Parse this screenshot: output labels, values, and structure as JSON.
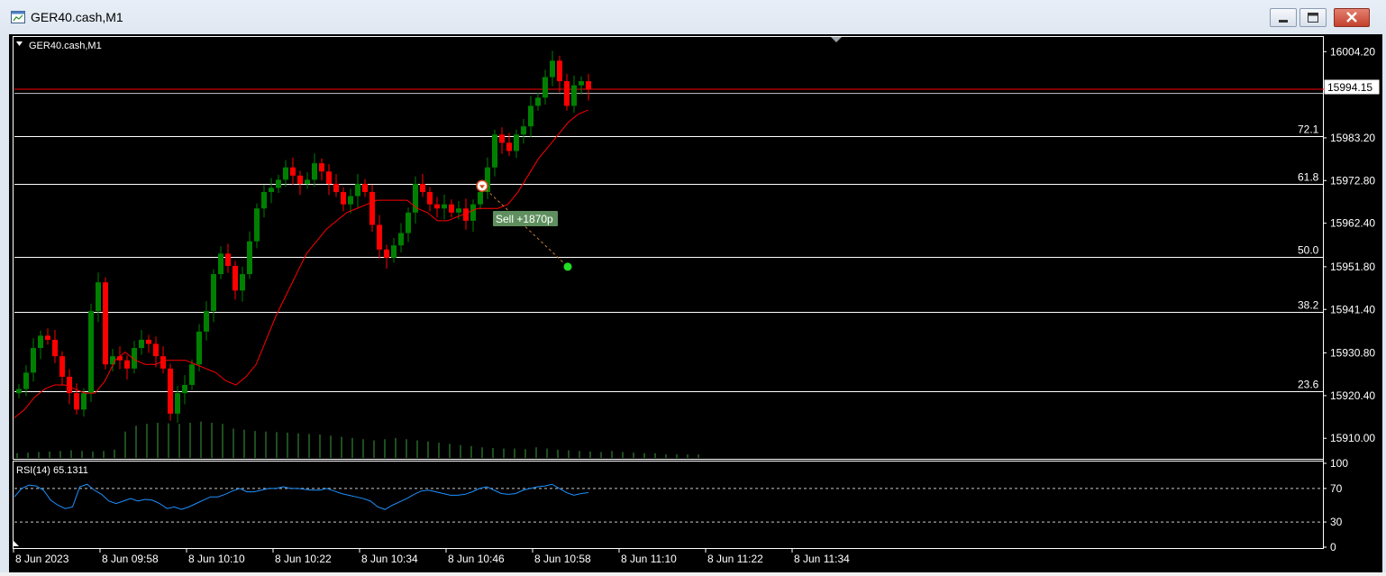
{
  "window": {
    "title": "GER40.cash,M1",
    "icons": {
      "app": "chart-window-icon",
      "minimize": "minimize-icon",
      "maximize": "maximize-icon",
      "close": "close-icon"
    }
  },
  "chart": {
    "symbol_label": "GER40.cash,M1",
    "current_price": "15994.15",
    "trade_label": "Sell +1870p",
    "rsi_label": "RSI(14) 65.1311",
    "colors": {
      "bull": "#008000",
      "bear": "#ff0000",
      "ma": "#ff0000",
      "rsi": "#1e90ff",
      "volume": "#3c9e3c"
    }
  },
  "chart_data": [
    {
      "type": "candlestick",
      "title": "GER40.cash,M1",
      "ylim": [
        15905,
        16008
      ],
      "price_ticks": [
        "16004.20",
        "15983.20",
        "15972.80",
        "15962.40",
        "15951.80",
        "15941.40",
        "15930.80",
        "15920.40",
        "15910.00"
      ],
      "time_labels": [
        "8 Jun 2023",
        "8 Jun 09:58",
        "8 Jun 10:10",
        "8 Jun 10:22",
        "8 Jun 10:34",
        "8 Jun 10:46",
        "8 Jun 10:58",
        "8 Jun 11:10",
        "8 Jun 11:22",
        "8 Jun 11:34"
      ],
      "fibonacci_levels": [
        {
          "label": "72.1",
          "price": 15983.7
        },
        {
          "label": "61.8",
          "price": 15971.9
        },
        {
          "label": "50.0",
          "price": 15954.3
        },
        {
          "label": "38.2",
          "price": 15940.8
        },
        {
          "label": "23.6",
          "price": 15921.5
        }
      ],
      "closes": [
        15922,
        15926,
        15932,
        15935,
        15934,
        15930,
        15925,
        15921,
        15917,
        15921,
        15941,
        15948,
        15928,
        15930,
        15929,
        15927,
        15932,
        15934,
        15933,
        15930,
        15927,
        15916,
        15921,
        15923,
        15928,
        15936,
        15941,
        15950,
        15955,
        15952,
        15946,
        15950,
        15958,
        15966,
        15970,
        15971,
        15973,
        15976,
        15974,
        15972,
        15973,
        15977,
        15975,
        15972,
        15970,
        15967,
        15969,
        15972,
        15970,
        15962,
        15956,
        15954,
        15957,
        15960,
        15965,
        15972,
        15970,
        15967,
        15966,
        15967,
        15965,
        15966,
        15963,
        15967,
        15970,
        15976,
        15984,
        15982,
        15980,
        15984,
        15986,
        15991,
        15993,
        15998,
        16002,
        15997,
        15991,
        15996,
        15997,
        15995
      ],
      "ma_curve": [
        15915,
        15917,
        15920,
        15922,
        15923,
        15923,
        15922,
        15921,
        15921,
        15924,
        15929,
        15931,
        15929,
        15928,
        15928,
        15929,
        15929,
        15929,
        15928,
        15927,
        15926,
        15924,
        15923,
        15925,
        15928,
        15934,
        15940,
        15945,
        15950,
        15955,
        15958,
        15961,
        15963,
        15965,
        15966,
        15967,
        15968,
        15968,
        15968,
        15968,
        15966,
        15965,
        15963,
        15963,
        15964,
        15965,
        15966,
        15966,
        15966,
        15967,
        15970,
        15974,
        15978,
        15981,
        15984,
        15987,
        15989,
        15990
      ],
      "volumes": [
        8,
        9,
        10,
        11,
        12,
        13,
        12,
        11,
        12,
        14,
        45,
        55,
        58,
        60,
        59,
        58,
        60,
        62,
        60,
        58,
        50,
        48,
        46,
        45,
        44,
        43,
        42,
        41,
        40,
        38,
        36,
        34,
        32,
        30,
        32,
        34,
        32,
        30,
        28,
        26,
        24,
        22,
        20,
        18,
        17,
        16,
        16,
        15,
        18,
        16,
        14,
        13,
        12,
        11,
        10,
        12,
        10,
        9,
        8,
        8,
        6,
        6,
        6,
        6
      ],
      "trade": {
        "entry_price": 15971.5,
        "exit_price": 15951.8,
        "direction": "sell",
        "result": "Sell +1870p"
      }
    },
    {
      "type": "line",
      "title": "RSI(14) 65.1311",
      "ylim": [
        0,
        100
      ],
      "y_ticks": [
        "100",
        "70",
        "30",
        "0"
      ],
      "levels": [
        70,
        30
      ],
      "values": [
        60,
        70,
        74,
        73,
        68,
        56,
        50,
        46,
        48,
        72,
        75,
        68,
        63,
        55,
        52,
        55,
        58,
        55,
        57,
        56,
        52,
        46,
        48,
        45,
        48,
        52,
        56,
        60,
        60,
        63,
        67,
        70,
        66,
        66,
        68,
        70,
        70,
        72,
        70,
        70,
        69,
        68,
        68,
        70,
        67,
        64,
        62,
        60,
        58,
        55,
        48,
        45,
        50,
        54,
        58,
        63,
        67,
        68,
        66,
        64,
        62,
        62,
        63,
        66,
        70,
        72,
        68,
        64,
        63,
        64,
        68,
        70,
        72,
        73,
        75,
        70,
        65,
        62,
        64,
        65
      ]
    }
  ]
}
